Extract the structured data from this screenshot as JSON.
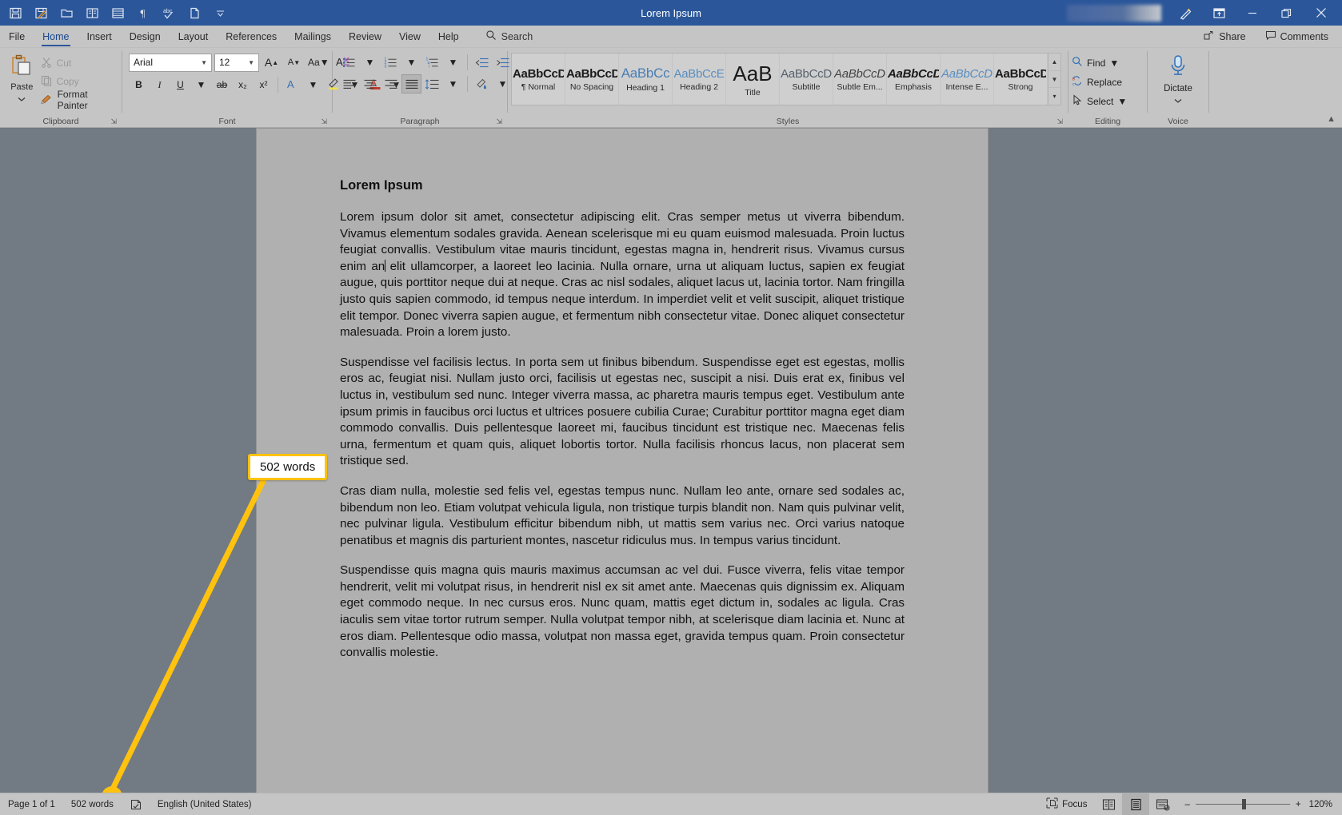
{
  "titlebar": {
    "title": "Lorem Ipsum",
    "quick_access": [
      {
        "name": "save-icon",
        "label": "Save"
      },
      {
        "name": "autosave-icon",
        "label": "AutoSave / Save As"
      },
      {
        "name": "open-folder-icon",
        "label": "Open"
      },
      {
        "name": "read-mode-icon",
        "label": "Read Mode"
      },
      {
        "name": "print-preview-icon",
        "label": "Print Preview"
      },
      {
        "name": "pilcrow-icon",
        "label": "Show/Hide Formatting Marks"
      },
      {
        "name": "spelling-check-icon",
        "label": "Spelling & Grammar"
      },
      {
        "name": "new-document-icon",
        "label": "New"
      },
      {
        "name": "customize-qat-chevron-icon",
        "label": "Customize Quick Access Toolbar"
      }
    ],
    "account_name": "",
    "window_buttons": [
      {
        "name": "pen-touch-icon",
        "label": "Touch/Mouse Mode"
      },
      {
        "name": "ribbon-display-options-icon",
        "label": "Ribbon Display Options"
      },
      {
        "name": "minimize-icon",
        "label": "Minimize"
      },
      {
        "name": "restore-icon",
        "label": "Restore Down"
      },
      {
        "name": "close-icon",
        "label": "Close"
      }
    ]
  },
  "tabs": {
    "items": [
      "File",
      "Home",
      "Insert",
      "Design",
      "Layout",
      "References",
      "Mailings",
      "Review",
      "View",
      "Help"
    ],
    "active": "Home",
    "search_label": "Search",
    "share_label": "Share",
    "comments_label": "Comments"
  },
  "ribbon": {
    "clipboard": {
      "label": "Clipboard",
      "paste_label": "Paste",
      "cut_label": "Cut",
      "copy_label": "Copy",
      "format_painter_label": "Format Painter"
    },
    "font": {
      "label": "Font",
      "font_name": "Arial",
      "font_size": "12",
      "grow_font": "A",
      "shrink_font": "A",
      "change_case": "Aa",
      "clear_formatting": "A",
      "bold": "B",
      "italic": "I",
      "underline": "U",
      "strikethrough": "ab",
      "subscript": "x₂",
      "superscript": "x²",
      "text_effects": "A",
      "highlight": "A",
      "font_color": "A"
    },
    "paragraph": {
      "label": "Paragraph",
      "bullets": "bullets-icon",
      "numbering": "numbering-icon",
      "multilevel": "multilevel-list-icon",
      "decrease_indent": "decrease-indent-icon",
      "increase_indent": "increase-indent-icon",
      "sort": "sort-icon",
      "show_marks": "pilcrow-icon",
      "align_left": "align-left-icon",
      "align_center": "align-center-icon",
      "align_right": "align-right-icon",
      "justify": "justify-icon",
      "line_spacing": "line-spacing-icon",
      "shading": "shading-icon",
      "borders": "borders-icon",
      "selected_alignment": "justify"
    },
    "styles": {
      "label": "Styles",
      "items": [
        {
          "preview": "AaBbCcDc",
          "name": "¶ Normal"
        },
        {
          "preview": "AaBbCcDc",
          "name": "No Spacing"
        },
        {
          "preview": "AaBbCс",
          "name": "Heading 1"
        },
        {
          "preview": "AaBbCcE",
          "name": "Heading 2"
        },
        {
          "preview": "AaB",
          "name": "Title"
        },
        {
          "preview": "AaBbCcD",
          "name": "Subtitle"
        },
        {
          "preview": "AaBbCcDu",
          "name": "Subtle Em..."
        },
        {
          "preview": "AaBbCcDu",
          "name": "Emphasis"
        },
        {
          "preview": "AaBbCcDu",
          "name": "Intense E..."
        },
        {
          "preview": "AaBbCcDc",
          "name": "Strong"
        }
      ]
    },
    "editing": {
      "label": "Editing",
      "find_label": "Find",
      "replace_label": "Replace",
      "select_label": "Select"
    },
    "voice": {
      "label": "Voice",
      "dictate_label": "Dictate"
    },
    "collapse_label": "Collapse the Ribbon"
  },
  "document": {
    "title": "Lorem Ipsum",
    "paragraphs": [
      "Lorem ipsum dolor sit amet, consectetur adipiscing elit. Cras semper metus ut viverra bibendum. Vivamus elementum sodales gravida. Aenean scelerisque mi eu quam euismod malesuada. Proin luctus feugiat convallis. Vestibulum vitae mauris tincidunt, egestas magna in, hendrerit risus. Vivamus cursus enim an elit ullamcorper, a laoreet leo lacinia. Nulla ornare, urna ut aliquam luctus, sapien ex feugiat augue, quis porttitor neque dui at neque. Cras ac nisl sodales, aliquet lacus ut, lacinia tortor. Nam fringilla justo quis sapien commodo, id tempus neque interdum. In imperdiet velit et velit suscipit, aliquet tristique elit tempor. Donec viverra sapien augue, et fermentum nibh consectetur vitae. Donec aliquet consectetur malesuada. Proin a lorem justo.",
      "Suspendisse vel facilisis lectus. In porta sem ut finibus bibendum. Suspendisse eget est egestas, mollis eros ac, feugiat nisi. Nullam justo orci, facilisis ut egestas nec, suscipit a nisi. Duis erat ex, finibus vel luctus in, vestibulum sed nunc. Integer viverra massa, ac pharetra mauris tempus eget. Vestibulum ante ipsum primis in faucibus orci luctus et ultrices posuere cubilia Curae; Curabitur porttitor magna eget diam commodo convallis. Duis pellentesque laoreet mi, faucibus tincidunt est tristique nec. Maecenas felis urna, fermentum et quam quis, aliquet lobortis tortor. Nulla facilisis rhoncus lacus, non placerat sem tristique sed.",
      "Cras diam nulla, molestie sed felis vel, egestas tempus nunc. Nullam leo ante, ornare sed sodales ac, bibendum non leo. Etiam volutpat vehicula ligula, non tristique turpis blandit non. Nam quis pulvinar velit, nec pulvinar ligula. Vestibulum efficitur bibendum nibh, ut mattis sem varius nec. Orci varius natoque penatibus et magnis dis parturient montes, nascetur ridiculus mus. In tempus varius tincidunt.",
      "Suspendisse quis magna quis mauris maximus accumsan ac vel dui. Fusce viverra, felis vitae tempor hendrerit, velit mi volutpat risus, in hendrerit nisl ex sit amet ante. Maecenas quis dignissim ex. Aliquam eget commodo neque. In nec cursus eros. Nunc quam, mattis eget dictum in, sodales ac ligula. Cras iaculis sem vitae tortor rutrum semper. Nulla volutpat tempor nibh, at scelerisque diam lacinia et. Nunc at eros diam. Pellentesque odio massa, volutpat non massa eget, gravida tempus quam. Proin consectetur convallis molestie."
    ]
  },
  "callout": {
    "text": "502 words",
    "border_color": "#ffc20e"
  },
  "statusbar": {
    "page_label": "Page 1 of 1",
    "word_count": "502 words",
    "proofing_icon": "proofing-errors-icon",
    "language": "English (United States)",
    "focus_label": "Focus",
    "views": [
      {
        "name": "read-mode-view-icon",
        "active": false
      },
      {
        "name": "print-layout-view-icon",
        "active": true
      },
      {
        "name": "web-layout-view-icon",
        "active": false
      }
    ],
    "zoom_out": "–",
    "zoom_in": "+",
    "zoom_level": "120%"
  }
}
